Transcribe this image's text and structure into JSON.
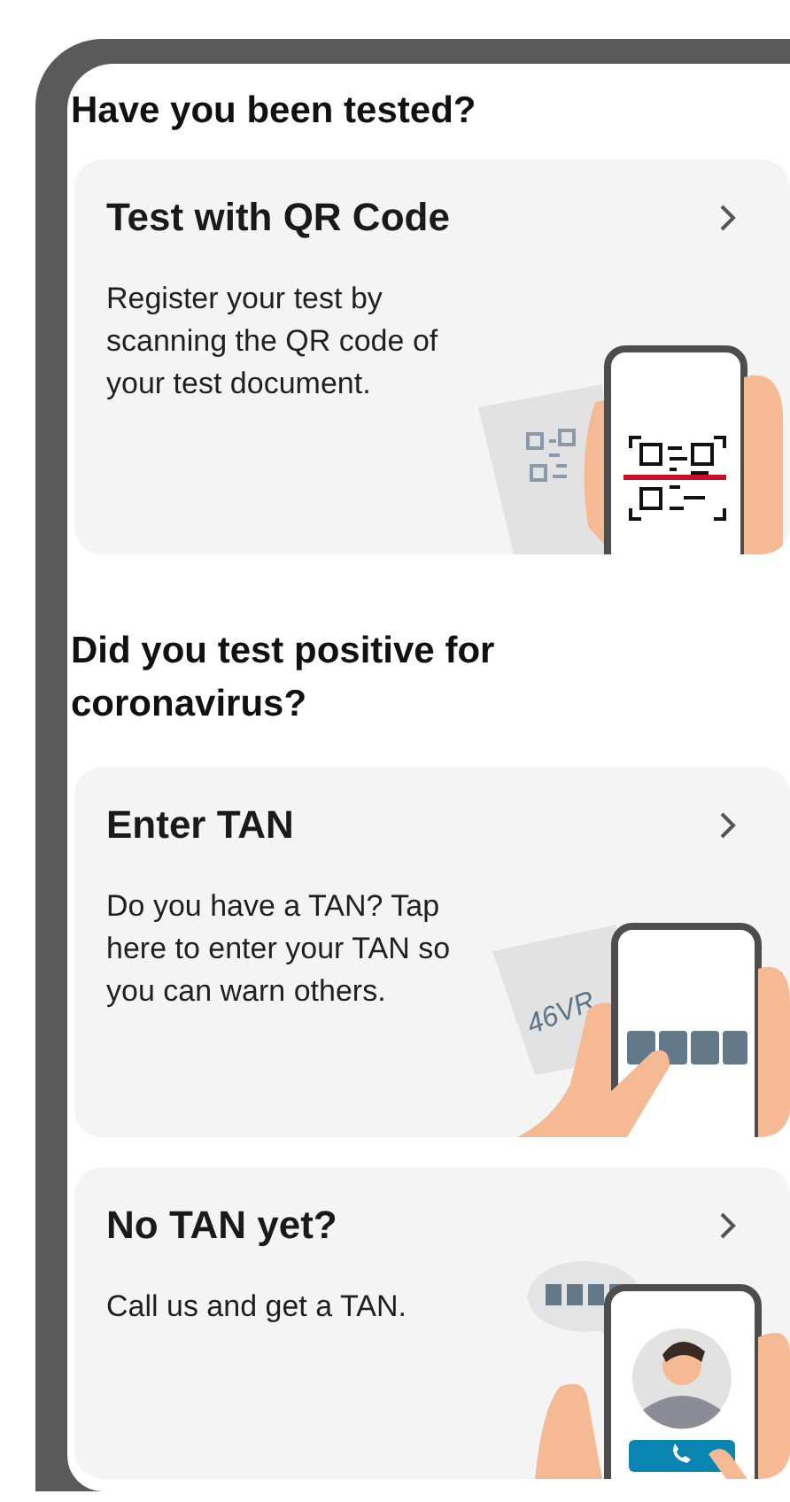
{
  "sections": [
    {
      "heading": "Have you been tested?",
      "cards": [
        {
          "kind": "qr",
          "title": "Test with QR Code",
          "description": "Register your test by scanning the QR code of your test document."
        }
      ]
    },
    {
      "heading": "Did you test positive for coronavirus?",
      "cards": [
        {
          "kind": "tan",
          "title": "Enter TAN",
          "description": "Do you have a TAN? Tap here to enter your TAN so you can warn others.",
          "illustration_text": "46VR"
        },
        {
          "kind": "hotline",
          "title": "No TAN yet?",
          "description": "Call us and get a TAN."
        }
      ]
    }
  ]
}
